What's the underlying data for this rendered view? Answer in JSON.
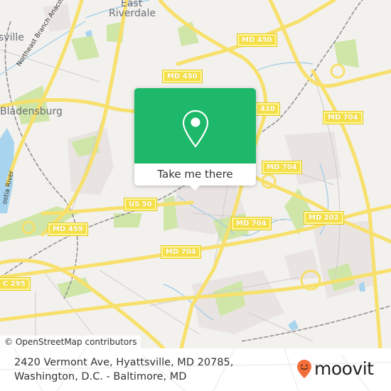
{
  "map": {
    "place_labels": {
      "east_riverdale_1": "East",
      "east_riverdale_2": "Riverdale",
      "hyattsville": "sville",
      "bladensburg": "Bladensburg"
    },
    "water_labels": {
      "northeast_branch": "Northeast Branch Anacostia",
      "anacostia_river": "ostia River"
    },
    "road_shields": {
      "md450_a": "MD 450",
      "md450_b": "MD 450",
      "md410": "410",
      "md704_a": "MD 704",
      "md704_b": "MD 704",
      "md704_c": "MD 704",
      "md704_d": "MD 704",
      "md202": "MD 202",
      "md459": "MD 459",
      "us50": "US 50",
      "dc295": "C 295"
    },
    "attribution": "© OpenStreetMap contributors"
  },
  "popup": {
    "icon": "location-pin-icon",
    "button_label": "Take me there",
    "color": "#1db86a"
  },
  "footer": {
    "address_line1": "2420 Vermont Ave, Hyattsville, MD 20785,",
    "address_line2": "Washington, D.C. - Baltimore, MD",
    "brand": "moovit",
    "brand_color": "#f26f3a"
  }
}
